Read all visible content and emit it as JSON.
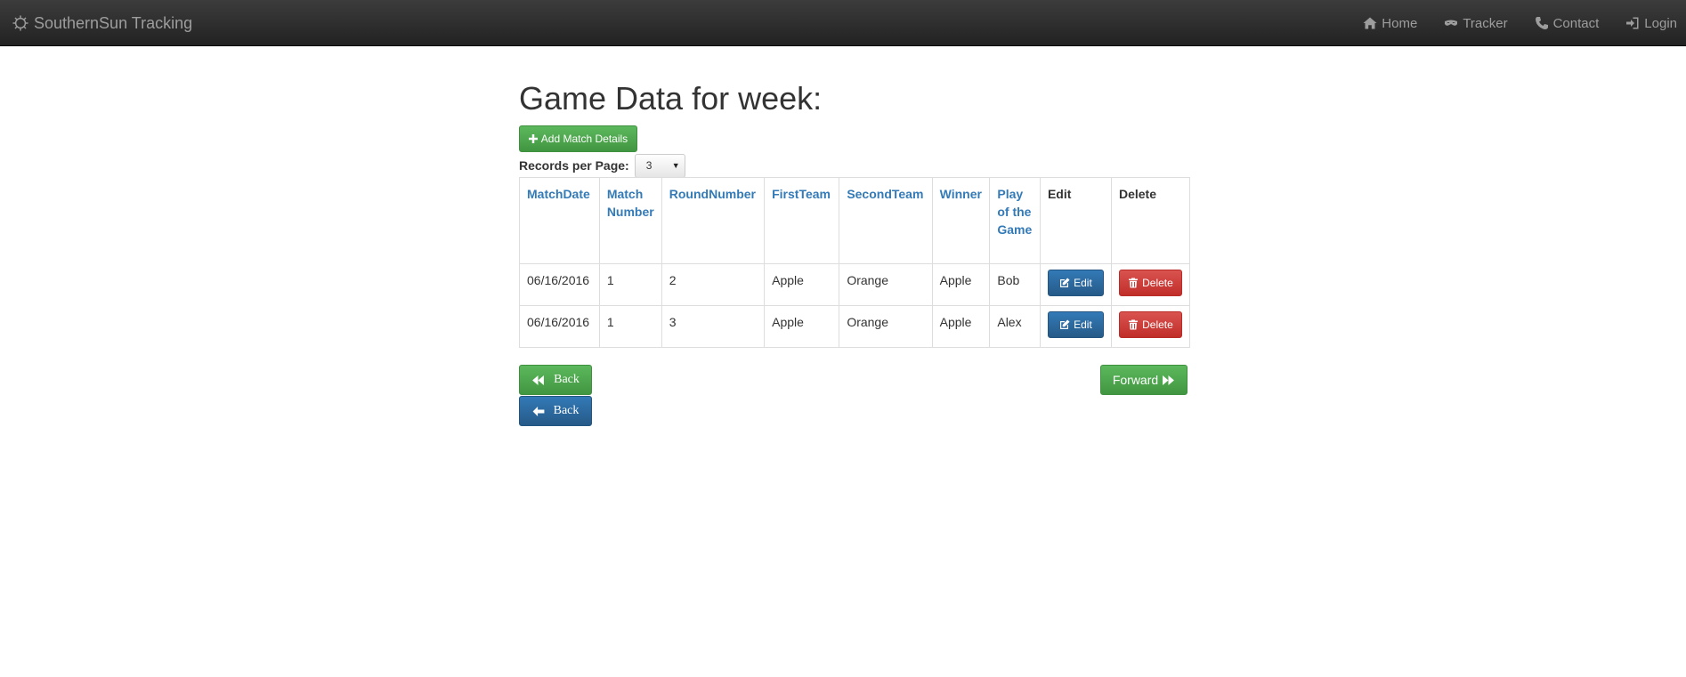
{
  "navbar": {
    "brand": "SouthernSun Tracking",
    "links": [
      {
        "label": "Home",
        "icon": "home-icon"
      },
      {
        "label": "Tracker",
        "icon": "eye-mask-icon"
      },
      {
        "label": "Contact",
        "icon": "phone-icon"
      },
      {
        "label": "Login",
        "icon": "login-icon"
      }
    ]
  },
  "page": {
    "title": "Game Data for week:",
    "add_button": "Add Match Details",
    "records_label": "Records per Page:",
    "records_value": "3"
  },
  "table": {
    "headers": [
      {
        "label": "MatchDate",
        "sortable": true
      },
      {
        "label": "Match Number",
        "sortable": true
      },
      {
        "label": "RoundNumber",
        "sortable": true
      },
      {
        "label": "FirstTeam",
        "sortable": true
      },
      {
        "label": "SecondTeam",
        "sortable": true
      },
      {
        "label": "Winner",
        "sortable": true
      },
      {
        "label": "Play of the Game",
        "sortable": true
      },
      {
        "label": "Edit",
        "sortable": false
      },
      {
        "label": "Delete",
        "sortable": false
      }
    ],
    "rows": [
      {
        "date": "06/16/2016",
        "match": "1",
        "round": "2",
        "first": "Apple",
        "second": "Orange",
        "winner": "Apple",
        "potg": "Bob",
        "edit": "Edit",
        "delete": "Delete"
      },
      {
        "date": "06/16/2016",
        "match": "1",
        "round": "3",
        "first": "Apple",
        "second": "Orange",
        "winner": "Apple",
        "potg": "Alex",
        "edit": "Edit",
        "delete": "Delete"
      }
    ]
  },
  "pager": {
    "back_label": "Back",
    "back2_label": "Back",
    "forward_label": "Forward"
  },
  "colors": {
    "navbar": "#222222",
    "link": "#337ab7",
    "success": "#5cb85c",
    "primary": "#337ab7",
    "danger": "#d9534f"
  }
}
